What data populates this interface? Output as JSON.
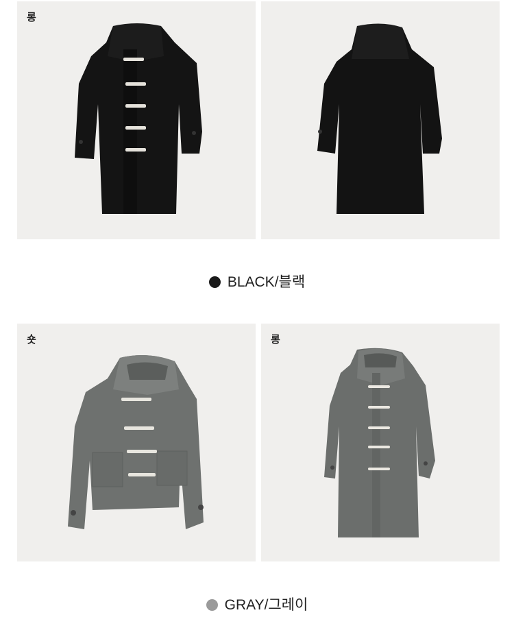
{
  "colors": {
    "black_swatch": "#1a1a1a",
    "gray_swatch": "#9a9a9a",
    "panel_bg": "#f0efed"
  },
  "sections": [
    {
      "swatch_color": "#1a1a1a",
      "caption": "BLACK/블랙",
      "photos": [
        {
          "tag": "롱",
          "view": "front",
          "coat": "long-duffle-coat-black"
        },
        {
          "tag": "",
          "view": "back",
          "coat": "long-duffle-coat-black"
        }
      ]
    },
    {
      "swatch_color": "#9a9a9a",
      "caption": "GRAY/그레이",
      "photos": [
        {
          "tag": "숏",
          "view": "front",
          "coat": "short-duffle-coat-gray"
        },
        {
          "tag": "롱",
          "view": "front",
          "coat": "long-duffle-coat-gray"
        }
      ]
    }
  ]
}
